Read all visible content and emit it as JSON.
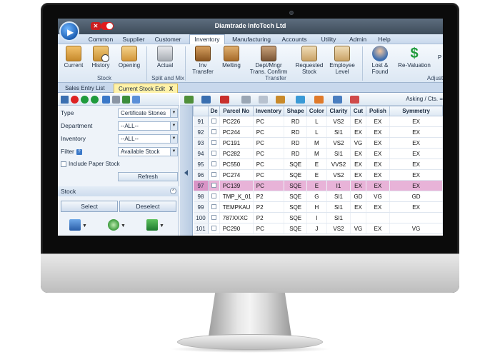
{
  "app": {
    "title": "Diamtrade InfoTech Ltd",
    "colors": {
      "title_bar": "#4d5c6c",
      "ribbon": "#dce7f3",
      "accent_red": "#cc1f1f",
      "selected_row": "#e8b3d8",
      "active_tab": "#fff2a8"
    }
  },
  "menu": [
    {
      "label": "Common"
    },
    {
      "label": "Supplier"
    },
    {
      "label": "Customer"
    },
    {
      "label": "Inventory"
    },
    {
      "label": "Manufacturing"
    },
    {
      "label": "Accounts"
    },
    {
      "label": "Utility"
    },
    {
      "label": "Admin"
    },
    {
      "label": "Help"
    }
  ],
  "menu_active": "Inventory",
  "ribbon": {
    "buttons": [
      {
        "label": "Current",
        "sub": "",
        "icon": "box-icon"
      },
      {
        "label": "History",
        "sub": "",
        "icon": "clock-icon"
      },
      {
        "label": "Opening",
        "sub": "",
        "icon": "open-box-icon"
      },
      {
        "label": "Actual",
        "sub": "",
        "icon": "split-icon"
      },
      {
        "label": "Inv",
        "sub": "Transfer",
        "icon": "home-icon"
      },
      {
        "label": "Melting",
        "sub": "",
        "icon": "melting-icon"
      },
      {
        "label": "Dept/Mngr",
        "sub": "Trans. Confirm",
        "icon": "gavel-icon"
      },
      {
        "label": "Requested",
        "sub": "Stock",
        "icon": "request-icon"
      },
      {
        "label": "Employee",
        "sub": "Level",
        "icon": "employee-icon"
      },
      {
        "label": "Lost &",
        "sub": "Found",
        "icon": "search-person-icon"
      },
      {
        "label": "Re-Valuation",
        "sub": "",
        "icon": "dollar-icon"
      }
    ],
    "groups": [
      {
        "label": "Stock"
      },
      {
        "label": "Split and Mix"
      },
      {
        "label": "Transfer"
      },
      {
        "label": "Adjust"
      }
    ],
    "cut_p": "P"
  },
  "doc_tabs": [
    {
      "label": "Sales Entry List"
    },
    {
      "label": "Current Stock Edit"
    }
  ],
  "filters": {
    "type_label": "Type",
    "type_value": "Certificate Stones",
    "department_label": "Department",
    "department_value": "--ALL--",
    "inventory_label": "Inventory",
    "inventory_value": "--ALL--",
    "filter_label": "Filter",
    "filter_value": "Available Stock",
    "paper_stock_label": "Include Paper Stock",
    "refresh_label": "Refresh"
  },
  "stock_section": {
    "title": "Stock",
    "select_label": "Select",
    "deselect_label": "Deselect"
  },
  "grid_toolbar": {
    "asking_label": "Asking / Cts. ="
  },
  "grid": {
    "headers": [
      "",
      "De",
      "Parcel No",
      "Inventory",
      "Shape",
      "Color",
      "Clarity",
      "Cut",
      "Polish",
      "Symmetry"
    ],
    "rows": [
      {
        "num": "91",
        "parcel": "PC226",
        "inv": "PC",
        "shape": "RD",
        "color": "L",
        "clarity": "VS2",
        "cut": "EX",
        "polish": "EX",
        "sym": "EX"
      },
      {
        "num": "92",
        "parcel": "PC244",
        "inv": "PC",
        "shape": "RD",
        "color": "L",
        "clarity": "SI1",
        "cut": "EX",
        "polish": "EX",
        "sym": "EX"
      },
      {
        "num": "93",
        "parcel": "PC191",
        "inv": "PC",
        "shape": "RD",
        "color": "M",
        "clarity": "VS2",
        "cut": "VG",
        "polish": "EX",
        "sym": "EX"
      },
      {
        "num": "94",
        "parcel": "PC282",
        "inv": "PC",
        "shape": "RD",
        "color": "M",
        "clarity": "SI1",
        "cut": "EX",
        "polish": "EX",
        "sym": "EX"
      },
      {
        "num": "95",
        "parcel": "PC550",
        "inv": "PC",
        "shape": "SQE",
        "color": "E",
        "clarity": "VVS2",
        "cut": "EX",
        "polish": "EX",
        "sym": "EX"
      },
      {
        "num": "96",
        "parcel": "PC274",
        "inv": "PC",
        "shape": "SQE",
        "color": "E",
        "clarity": "VS2",
        "cut": "EX",
        "polish": "EX",
        "sym": "EX"
      },
      {
        "num": "97",
        "parcel": "PC139",
        "inv": "PC",
        "shape": "SQE",
        "color": "E",
        "clarity": "I1",
        "cut": "EX",
        "polish": "EX",
        "sym": "EX"
      },
      {
        "num": "98",
        "parcel": "TMP_K_01",
        "inv": "P2",
        "shape": "SQE",
        "color": "G",
        "clarity": "SI1",
        "cut": "GD",
        "polish": "VG",
        "sym": "GD"
      },
      {
        "num": "99",
        "parcel": "TEMPKAU",
        "inv": "P2",
        "shape": "SQE",
        "color": "H",
        "clarity": "SI1",
        "cut": "EX",
        "polish": "EX",
        "sym": "EX"
      },
      {
        "num": "100",
        "parcel": "787XXXC",
        "inv": "P2",
        "shape": "SQE",
        "color": "I",
        "clarity": "SI1",
        "cut": "",
        "polish": "",
        "sym": ""
      },
      {
        "num": "101",
        "parcel": "PC290",
        "inv": "PC",
        "shape": "SQE",
        "color": "J",
        "clarity": "VS2",
        "cut": "VG",
        "polish": "EX",
        "sym": "VG"
      }
    ],
    "selected_row_index": 6
  }
}
